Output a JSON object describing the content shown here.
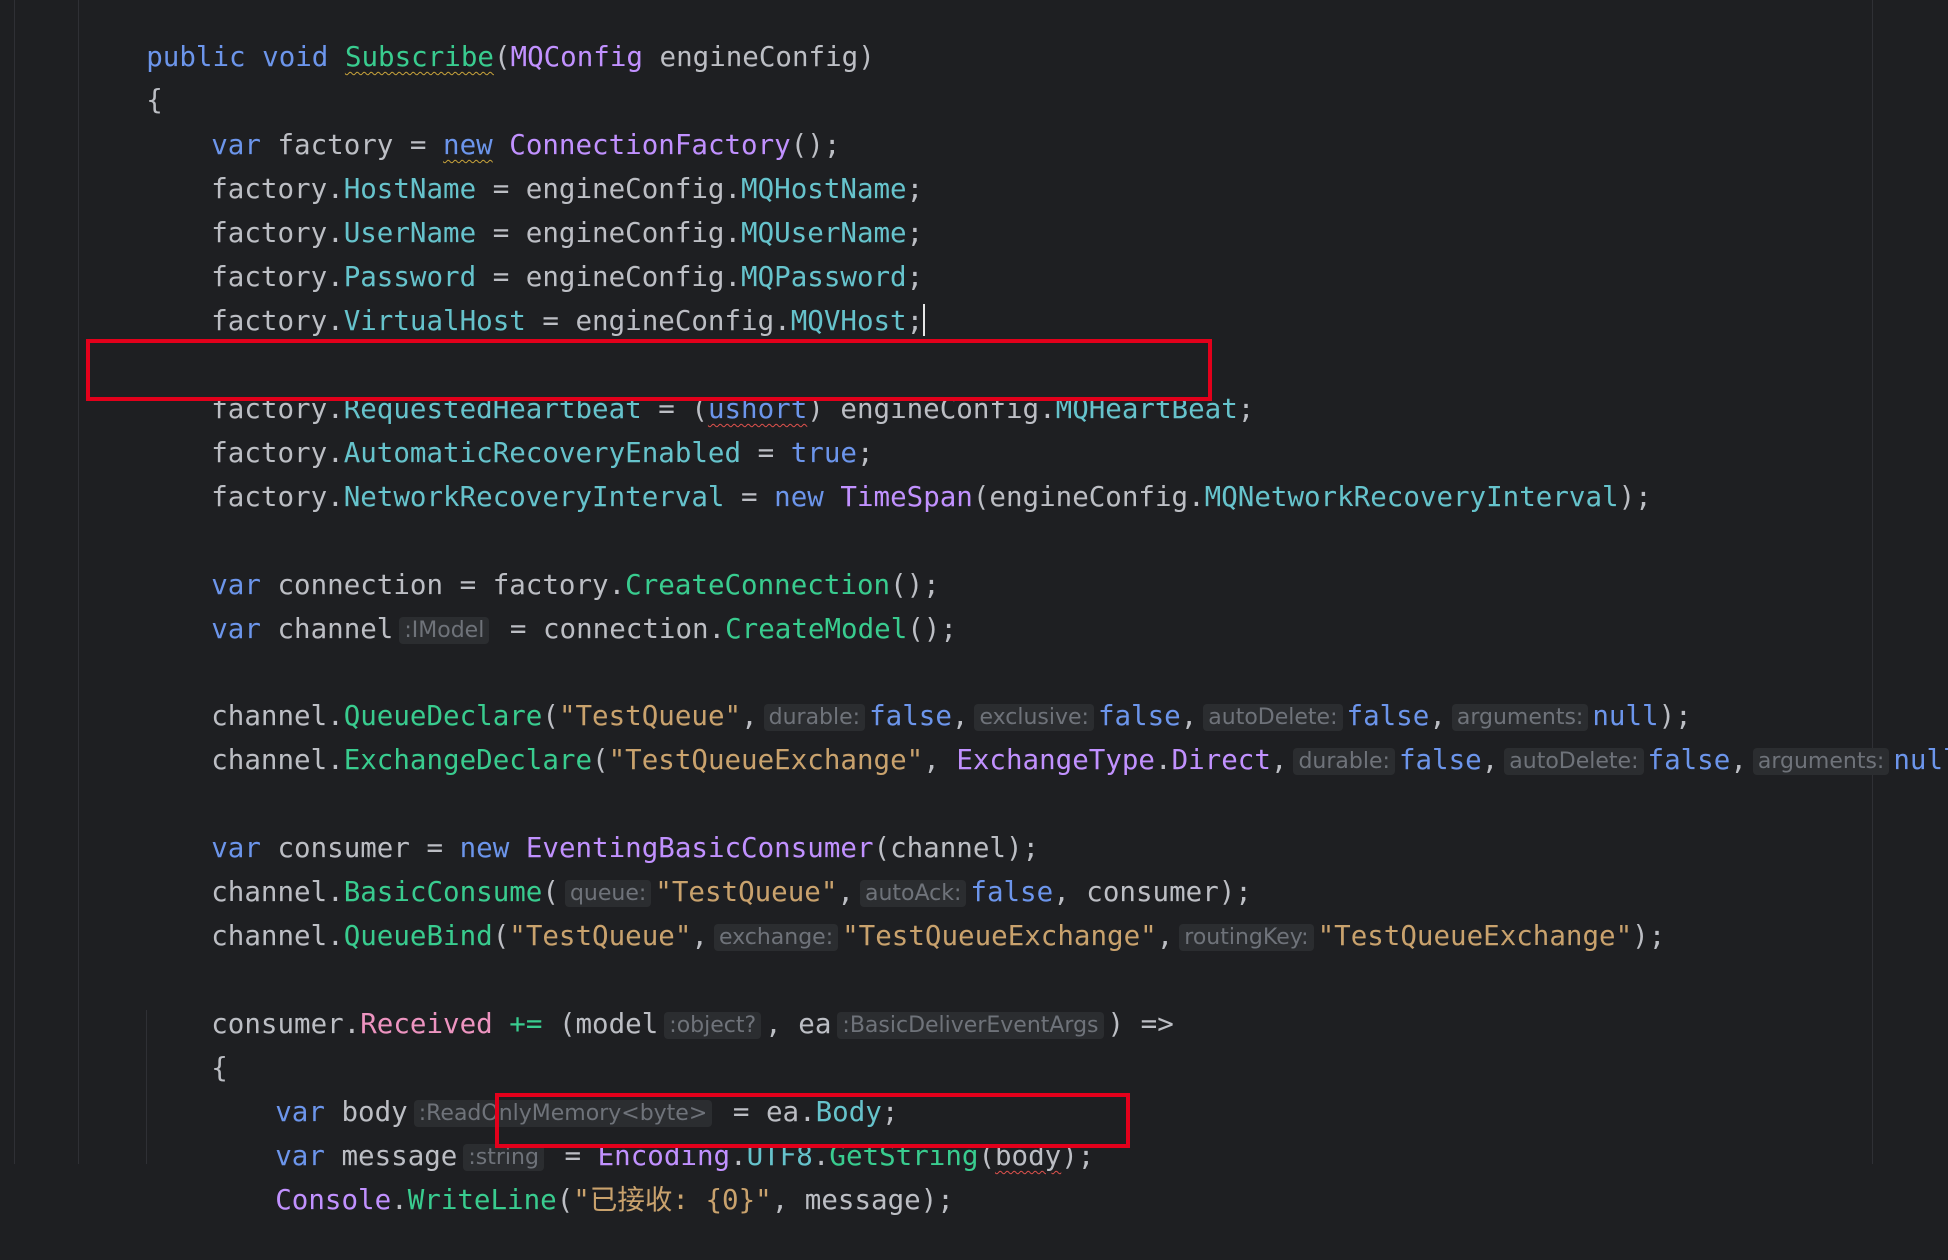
{
  "code": {
    "line1": {
      "kw1": "public",
      "kw2": "void",
      "method": "Subscribe",
      "paren_open": "(",
      "type": "MQConfig",
      "param": " engineConfig)"
    },
    "line2": {
      "text": "{"
    },
    "line3": {
      "kw": "var",
      "mid": " factory = ",
      "kw_new": "new",
      "type": "ConnectionFactory",
      "tail": "();"
    },
    "line4": {
      "a": "factory.",
      "prop": "HostName",
      "b": " = engineConfig.",
      "prop2": "MQHostName",
      "c": ";"
    },
    "line5": {
      "a": "factory.",
      "prop": "UserName",
      "b": " = engineConfig.",
      "prop2": "MQUserName",
      "c": ";"
    },
    "line6": {
      "a": "factory.",
      "prop": "Password",
      "b": " = engineConfig.",
      "prop2": "MQPassword",
      "c": ";"
    },
    "line7": {
      "a": "factory.",
      "prop": "VirtualHost",
      "b": " = engineConfig.",
      "prop2": "MQVHost",
      "c": ";"
    },
    "line8": {
      "a": "factory.",
      "prop": "RequestedHeartbeat",
      "b": " = (",
      "kw": "ushort",
      "c": ") engineConfig.",
      "prop2": "MQHeartBeat",
      "d": ";"
    },
    "line9": {
      "a": "factory.",
      "prop": "AutomaticRecoveryEnabled",
      "b": " = ",
      "kw": "true",
      "c": ";"
    },
    "line10": {
      "a": "factory.",
      "prop": "NetworkRecoveryInterval",
      "b": " = ",
      "kw": "new",
      "type": "TimeSpan",
      "c": "(engineConfig.",
      "prop2": "MQNetworkRecoveryInterval",
      "d": ");"
    },
    "line11": {
      "kw": "var",
      "a": " connection = factory.",
      "method": "CreateConnection",
      "b": "();"
    },
    "line12": {
      "kw": "var",
      "a": " channel",
      "hint": ":IModel",
      "b": " = connection.",
      "method": "CreateModel",
      "c": "();"
    },
    "line13": {
      "a": "channel.",
      "method": "QueueDeclare",
      "b": "(",
      "str": "\"TestQueue\"",
      "c": ",",
      "h1": "durable:",
      "v1": "false",
      "c1": ",",
      "h2": "exclusive:",
      "v2": "false",
      "c2": ",",
      "h3": "autoDelete:",
      "v3": "false",
      "c3": ",",
      "h4": "arguments:",
      "v4": "null",
      "d": ");"
    },
    "line14": {
      "a": "channel.",
      "method": "ExchangeDeclare",
      "b": "(",
      "str": "\"TestQueueExchange\"",
      "c": ", ",
      "type": "ExchangeType",
      "dot": ".",
      "prop": "Direct",
      "c0": ",",
      "h1": "durable:",
      "v1": "false",
      "c1": ",",
      "h2": "autoDelete:",
      "v2": "false",
      "c2": ",",
      "h3": "arguments:",
      "v3": "null",
      "d": ");"
    },
    "line15": {
      "kw": "var",
      "a": " consumer = ",
      "kw_new": "new",
      "type": "EventingBasicConsumer",
      "b": "(channel);"
    },
    "line16": {
      "a": "channel.",
      "method": "BasicConsume",
      "b": "(",
      "h1": "queue:",
      "s1": "\"TestQueue\"",
      "c1": ",",
      "h2": "autoAck:",
      "v2": "false",
      "c2": ", consumer);"
    },
    "line17": {
      "a": "channel.",
      "method": "QueueBind",
      "b": "(",
      "s1": "\"TestQueue\"",
      "c1": ",",
      "h2": "exchange:",
      "s2": "\"TestQueueExchange\"",
      "c2": ",",
      "h3": "routingKey:",
      "s3": "\"TestQueueExchange\"",
      "d": ");"
    },
    "line18": {
      "a": "consumer.",
      "event": "Received",
      "op": " += ",
      "b": "(model",
      "h1": ":object?",
      "c1": ", ea",
      "h2": ":BasicDeliverEventArgs",
      "c2": ") =>"
    },
    "line19": {
      "text": "{"
    },
    "line20": {
      "kw": "var",
      "a": " body",
      "hint": ":ReadOnlyMemory<byte>",
      "b": " = ea.",
      "prop": "Body",
      "c": ";"
    },
    "line21": {
      "kw": "var",
      "a": " message",
      "hint": ":string",
      "b": " = ",
      "type": "Encoding",
      "dot": ".",
      "prop": "UTF8",
      "dot2": ".",
      "method": "GetString",
      "c": "(",
      "arg": "body",
      "d": ");"
    },
    "line22": {
      "type": "Console",
      "dot": ".",
      "method": "WriteLine",
      "a": "(",
      "str": "\"已接收: {0}\"",
      "b": ", message);"
    }
  }
}
